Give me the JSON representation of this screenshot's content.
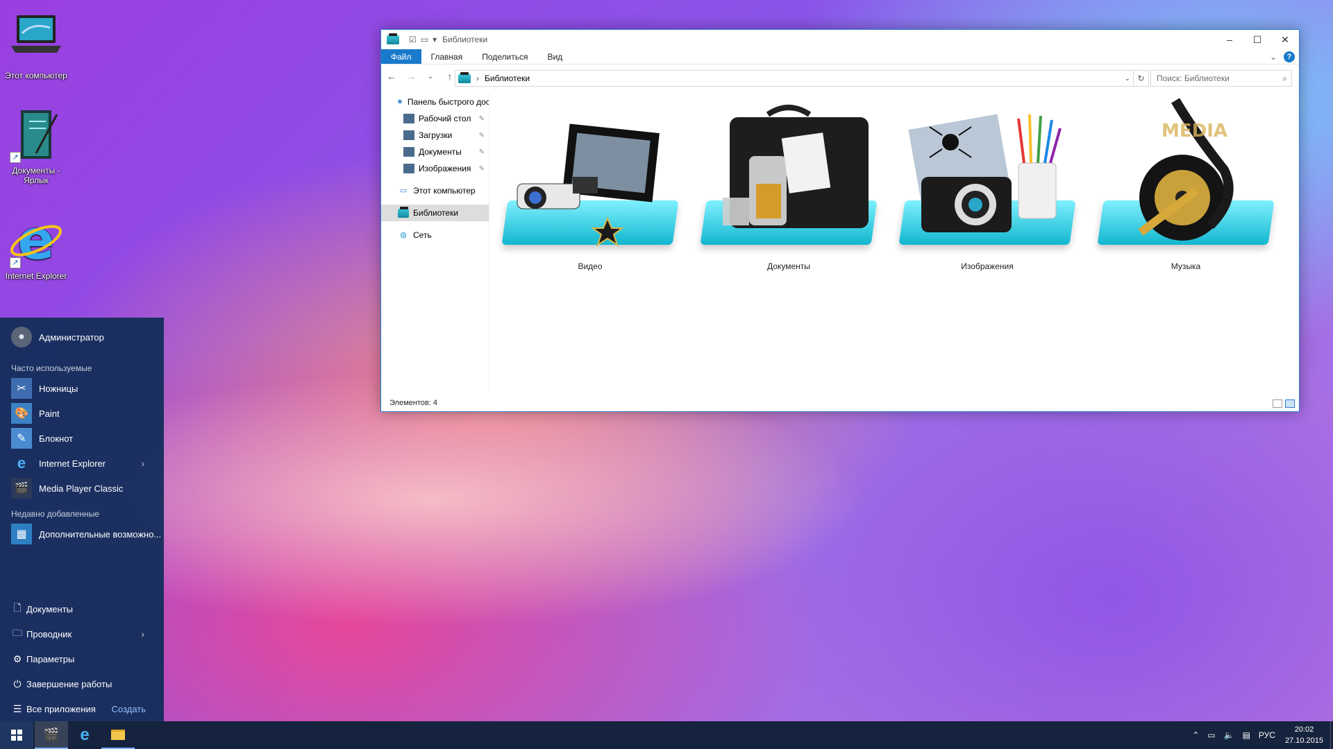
{
  "desktop": {
    "icons": [
      {
        "label": "Этот компьютер"
      },
      {
        "label": "Документы - Ярлык"
      },
      {
        "label": "Internet Explorer"
      }
    ]
  },
  "explorer": {
    "title": "Библиотеки",
    "tabs": {
      "file": "Файл",
      "home": "Главная",
      "share": "Поделиться",
      "view": "Вид"
    },
    "help": "?",
    "address": "Библиотеки",
    "search_placeholder": "Поиск: Библиотеки",
    "nav": {
      "quick": "Панель быстрого доступа",
      "desktop": "Рабочий стол",
      "downloads": "Загрузки",
      "documents": "Документы",
      "images": "Изображения",
      "pc": "Этот компьютер",
      "libraries": "Библиотеки",
      "network": "Сеть"
    },
    "libraries": [
      {
        "label": "Видео"
      },
      {
        "label": "Документы"
      },
      {
        "label": "Изображения"
      },
      {
        "label": "Музыка"
      }
    ],
    "status": "Элементов: 4"
  },
  "start_menu": {
    "user": "Администратор",
    "frequent_header": "Часто используемые",
    "frequent": [
      {
        "label": "Ножницы"
      },
      {
        "label": "Paint"
      },
      {
        "label": "Блокнот"
      },
      {
        "label": "Internet Explorer"
      },
      {
        "label": "Media Player Classic"
      }
    ],
    "recent_header": "Недавно добавленные",
    "recent": [
      {
        "label": "Дополнительные возможно..."
      }
    ],
    "bottom": {
      "documents": "Документы",
      "explorer": "Проводник",
      "settings": "Параметры",
      "shutdown": "Завершение работы",
      "all_apps": "Все приложения",
      "create": "Создать"
    }
  },
  "taskbar": {
    "lang": "РУС",
    "time": "20:02",
    "date": "27.10.2015"
  }
}
